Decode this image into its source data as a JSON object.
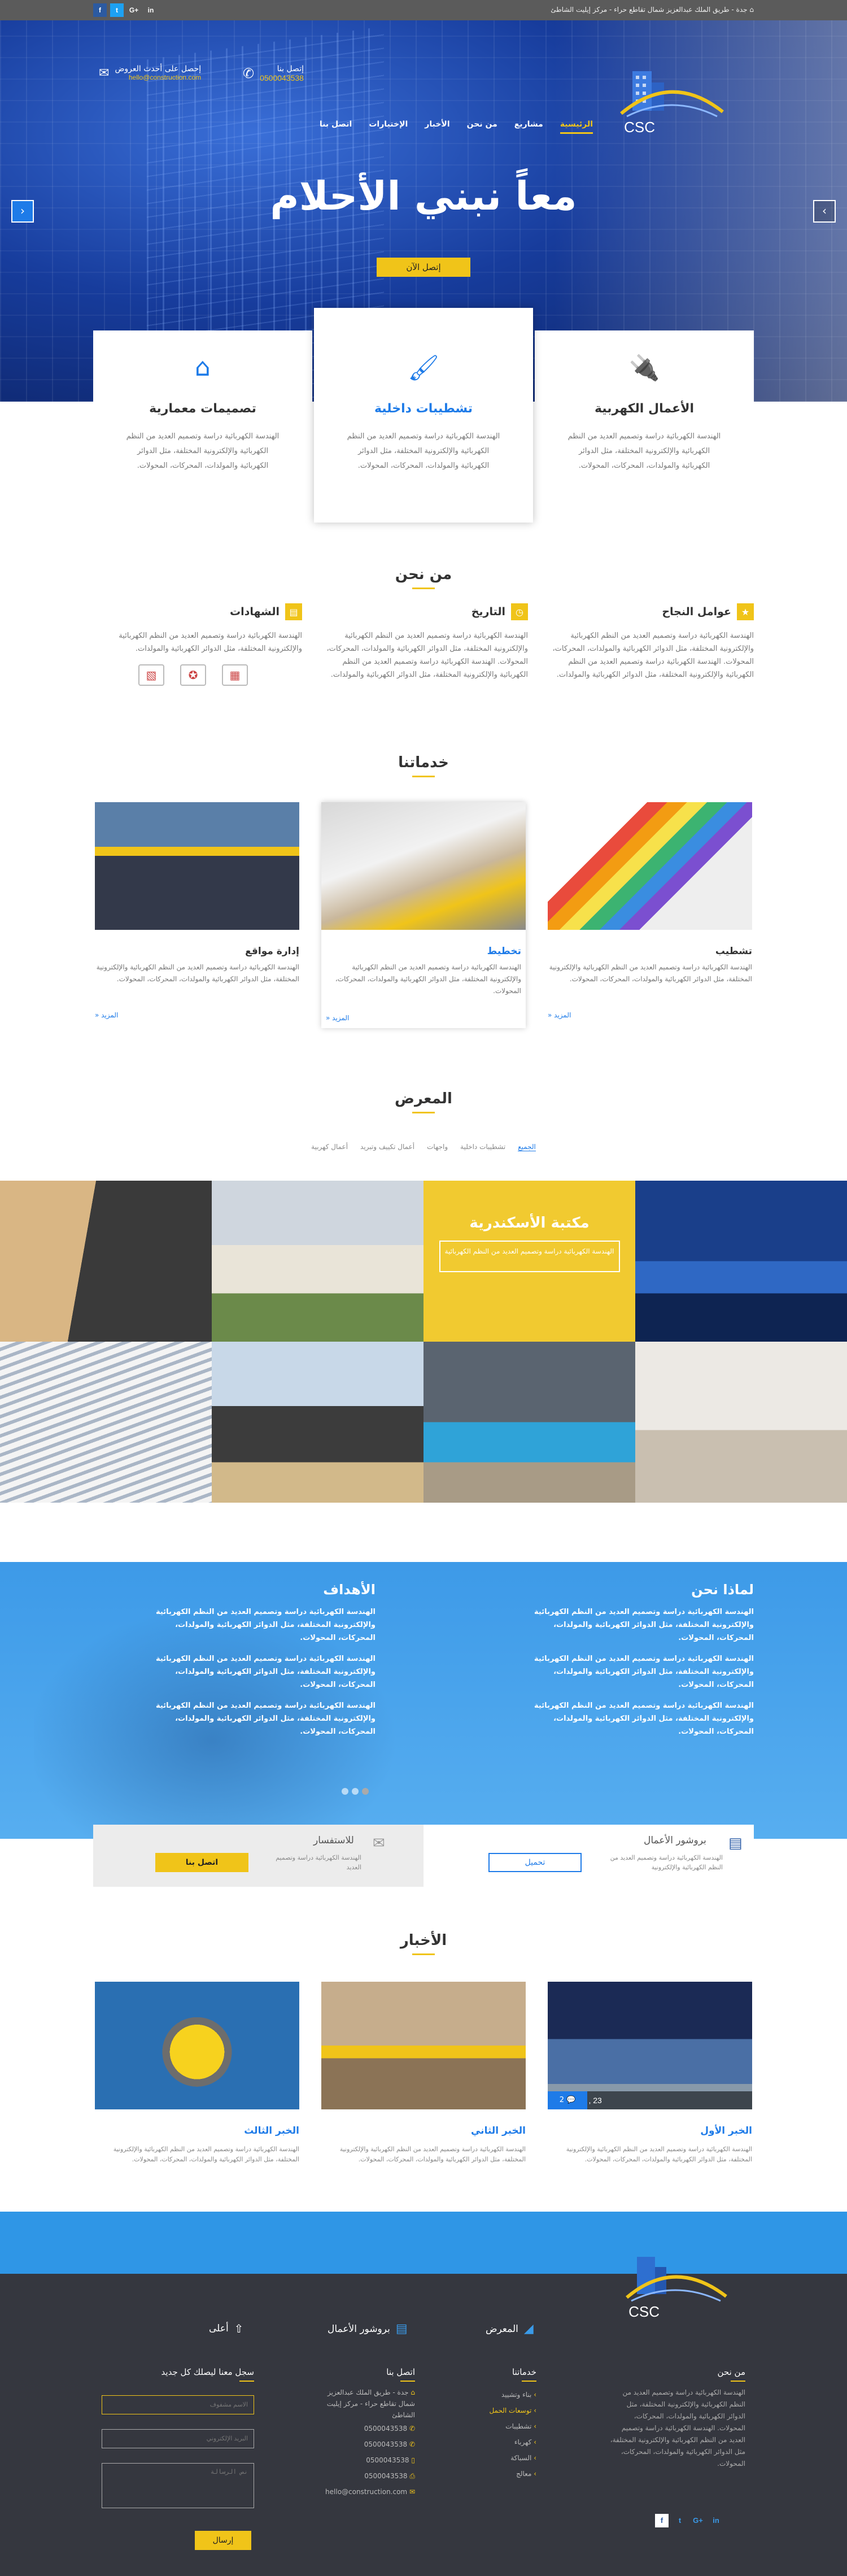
{
  "topbar": {
    "address": "جدة - طريق الملك عبدالعزيز شمال تقاطع حراء - مركز إيليت الشاطئ",
    "social": [
      "f",
      "t",
      "G+",
      "in"
    ]
  },
  "header": {
    "logo_text": "CSC",
    "phone_label": "إتصل بنا",
    "phone_value": "0500043538",
    "email_label": "إحصل على أحدث العروض",
    "email_value": "hello@construction.com",
    "nav": [
      "الرئيسية",
      "مشاريع",
      "من نحن",
      "الأخبار",
      "الإختيارات",
      "اتصل بنا"
    ]
  },
  "hero": {
    "headline": "معاً نبني الأحلام",
    "cta": "إتصل الآن",
    "prev": "‹",
    "next": "›"
  },
  "features": [
    {
      "icon": "plug-icon",
      "title": "الأعمال الكهربية",
      "text": "الهندسة الكهربائية دراسة وتصميم العديد من النظم الكهربائية والإلكترونية المختلفة، مثل الدوائر الكهربائية والمولدات، المحركات، المحولات."
    },
    {
      "icon": "paint-icon",
      "title": "تشطيبات داخلية",
      "text": "الهندسة الكهربائية دراسة وتصميم العديد من النظم الكهربائية والإلكترونية المختلفة، مثل الدوائر الكهربائية والمولدات، المحركات، المحولات."
    },
    {
      "icon": "house-icon",
      "title": "تصميمات معمارية",
      "text": "الهندسة الكهربائية دراسة وتصميم العديد من النظم الكهربائية والإلكترونية المختلفة، مثل الدوائر الكهربائية والمولدات، المحركات، المحولات."
    }
  ],
  "about": {
    "title": "من نحن",
    "cols": [
      {
        "title": "عوامل النجاح",
        "text": "الهندسة الكهربائية دراسة وتصميم العديد من النظم الكهربائية والإلكترونية المختلفة، مثل الدوائر الكهربائية والمولدات، المحركات، المحولات. الهندسة الكهربائية دراسة وتصميم العديد من النظم الكهربائية والإلكترونية المختلفة، مثل الدوائر الكهربائية والمولدات."
      },
      {
        "title": "التاريخ",
        "text": "الهندسة الكهربائية دراسة وتصميم العديد من النظم الكهربائية والإلكترونية المختلفة، مثل الدوائر الكهربائية والمولدات، المحركات، المحولات. الهندسة الكهربائية دراسة وتصميم العديد من النظم الكهربائية والإلكترونية المختلفة، مثل الدوائر الكهربائية والمولدات."
      },
      {
        "title": "الشهادات",
        "text": "الهندسة الكهربائية دراسة وتصميم العديد من النظم الكهربائية والإلكترونية المختلفة، مثل الدوائر الكهربائية والمولدات."
      }
    ]
  },
  "services": {
    "title": "خدماتنا",
    "items": [
      {
        "title": "تشطيب",
        "text": "الهندسة الكهربائية دراسة وتصميم العديد من النظم الكهربائية والإلكترونية المختلفة، مثل الدوائر الكهربائية والمولدات، المحركات، المحولات.",
        "more": "المزيد «"
      },
      {
        "title": "تخطيط",
        "text": "الهندسة الكهربائية دراسة وتصميم العديد من النظم الكهربائية والإلكترونية المختلفة، مثل الدوائر الكهربائية والمولدات، المحركات، المحولات.",
        "more": "المزيد «"
      },
      {
        "title": "إدارة مواقع",
        "text": "الهندسة الكهربائية دراسة وتصميم العديد من النظم الكهربائية والإلكترونية المختلفة، مثل الدوائر الكهربائية والمولدات، المحركات، المحولات.",
        "more": "المزيد «"
      }
    ]
  },
  "gallery": {
    "title": "المعرض",
    "filters": [
      "الجميع",
      "تشطيبات داخلية",
      "واجهات",
      "أعمال تكييف وتبريد",
      "أعمال كهربية"
    ],
    "caption_title": "مكتبة الأسكندرية",
    "caption_text": "الهندسة الكهربائية دراسة وتصميم العديد من النظم الكهربائية"
  },
  "why": {
    "title": "لماذا نحن",
    "items": [
      "الهندسة الكهربائية دراسة وتصميم العديد من النظم الكهربائية والإلكترونية المختلفة، مثل الدوائر الكهربائية والمولدات، المحركات، المحولات.",
      "الهندسة الكهربائية دراسة وتصميم العديد من النظم الكهربائية والإلكترونية المختلفة، مثل الدوائر الكهربائية والمولدات، المحركات، المحولات.",
      "الهندسة الكهربائية دراسة وتصميم العديد من النظم الكهربائية والإلكترونية المختلفة، مثل الدوائر الكهربائية والمولدات، المحركات، المحولات."
    ]
  },
  "goals": {
    "title": "الأهداف",
    "items": [
      "الهندسة الكهربائية دراسة وتصميم العديد من النظم الكهربائية والإلكترونية المختلفة، مثل الدوائر الكهربائية والمولدات، المحركات، المحولات.",
      "الهندسة الكهربائية دراسة وتصميم العديد من النظم الكهربائية والإلكترونية المختلفة، مثل الدوائر الكهربائية والمولدات، المحركات، المحولات.",
      "الهندسة الكهربائية دراسة وتصميم العديد من النظم الكهربائية والإلكترونية المختلفة، مثل الدوائر الكهربائية والمولدات، المحركات، المحولات."
    ]
  },
  "brochure": {
    "title": "بروشور الأعمال",
    "text": "الهندسة الكهربائية دراسة وتصميم العديد من النظم الكهربائية والإلكترونية",
    "button": "تحميل"
  },
  "consult": {
    "title": "للاستفسار",
    "text": "الهندسة الكهربائية دراسة وتصميم العديد",
    "button": "اتصل بنا"
  },
  "news": {
    "title": "الأخبار",
    "items": [
      {
        "title": "الخبر الأول",
        "text": "الهندسة الكهربائية دراسة وتصميم العديد من النظم الكهربائية والإلكترونية المختلفة، مثل الدوائر الكهربائية والمولدات، المحركات، المحولات.",
        "date": "2017 , 3 , 23",
        "comments": "2"
      },
      {
        "title": "الخبر الثاني",
        "text": "الهندسة الكهربائية دراسة وتصميم العديد من النظم الكهربائية والإلكترونية المختلفة، مثل الدوائر الكهربائية والمولدات، المحركات، المحولات."
      },
      {
        "title": "الخبر الثالث",
        "text": "الهندسة الكهربائية دراسة وتصميم العديد من النظم الكهربائية والإلكترونية المختلفة، مثل الدوائر الكهربائية والمولدات، المحركات، المحولات."
      }
    ]
  },
  "footer": {
    "logo_text": "CSC",
    "links": [
      "المعرض",
      "بروشور الأعمال",
      "أعلى"
    ],
    "about_title": "من نحن",
    "about_text": "الهندسة الكهربائية دراسة وتصميم العديد من النظم الكهربائية والإلكترونية المختلفة، مثل الدوائر الكهربائية والمولدات، المحركات، المحولات. الهندسة الكهربائية دراسة وتصميم العديد من النظم الكهربائية والإلكترونية المختلفة، مثل الدوائر الكهربائية والمولدات، المحركات، المحولات.",
    "services_title": "خدماتنا",
    "services": [
      "بناء وتشييد",
      "توسعات الحمل",
      "تشطيبات",
      "كهرباء",
      "السباكة",
      "معالج"
    ],
    "contact_title": "اتصل بنا",
    "contact_address": "جدة - طريق الملك عبدالعزيز شمال تقاطع حراء - مركز إيليت الشاطئ",
    "phones": [
      "0500043538",
      "0500043538",
      "0500043538"
    ],
    "fax": "0500043538",
    "email": "hello@construction.com",
    "newsletter_title": "سجل معنا ليصلك كل جديد",
    "name_placeholder": "الاسم مشفوف",
    "email_placeholder": "البريد الإلكتروني",
    "msg_placeholder": "نص الرسالة",
    "send": "إرسال",
    "social": [
      "f",
      "t",
      "G+",
      "in"
    ]
  }
}
